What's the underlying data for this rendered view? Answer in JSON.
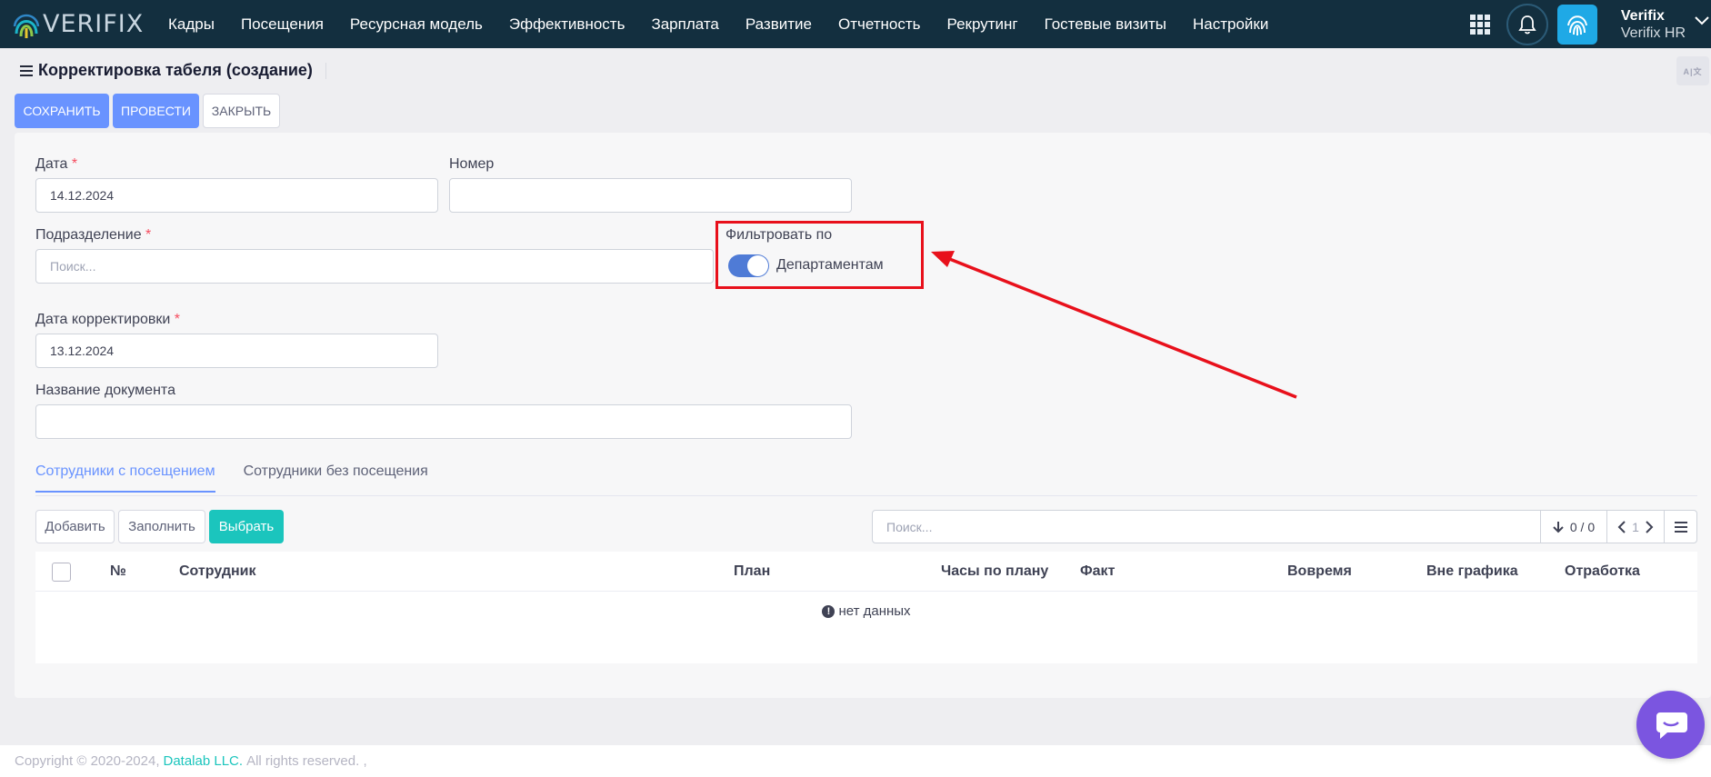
{
  "app": {
    "logo_text": "VERIFIX",
    "menu": [
      "Кадры",
      "Посещения",
      "Ресурсная модель",
      "Эффективность",
      "Зарплата",
      "Развитие",
      "Отчетность",
      "Рекрутинг",
      "Гостевые визиты",
      "Настройки"
    ],
    "user": {
      "name": "Verifix",
      "org": "Verifix HR"
    }
  },
  "page": {
    "title": "Корректировка табеля (создание)",
    "lang_toggle": "A|文",
    "buttons": {
      "save": "Сохранить",
      "post": "Провести",
      "close": "Закрыть"
    }
  },
  "form": {
    "date": {
      "label": "Дата",
      "required": "*",
      "value": "14.12.2024"
    },
    "number": {
      "label": "Номер",
      "value": ""
    },
    "division": {
      "label": "Подразделение",
      "required": "*",
      "placeholder": "Поиск..."
    },
    "filter": {
      "label": "Фильтровать по",
      "toggle_label": "Департаментам",
      "enabled": true
    },
    "correction_date": {
      "label": "Дата корректировки",
      "required": "*",
      "value": "13.12.2024"
    },
    "doc_name": {
      "label": "Название документа",
      "value": ""
    }
  },
  "tabs": [
    {
      "label": "Сотрудники с посещением",
      "active": true
    },
    {
      "label": "Сотрудники без посещения",
      "active": false
    }
  ],
  "grid": {
    "buttons": {
      "add": "Добавить",
      "fill": "Заполнить",
      "select": "Выбрать"
    },
    "search_placeholder": "Поиск...",
    "count": "0 / 0",
    "page": "1",
    "columns": [
      "№",
      "Сотрудник",
      "План",
      "Часы по плану",
      "Факт",
      "Вовремя",
      "Вне графика",
      "Отработка"
    ],
    "empty_text": "нет данных"
  },
  "footer": {
    "copyright": "Copyright © 2020-2024,",
    "company": "Datalab LLC.",
    "rights": "All rights reserved. ,"
  },
  "colors": {
    "nav_bg": "#132f3f",
    "primary": "#6993ff",
    "info": "#1bc5bd",
    "highlight": "#e8101b",
    "chat": "#7b55e0"
  }
}
